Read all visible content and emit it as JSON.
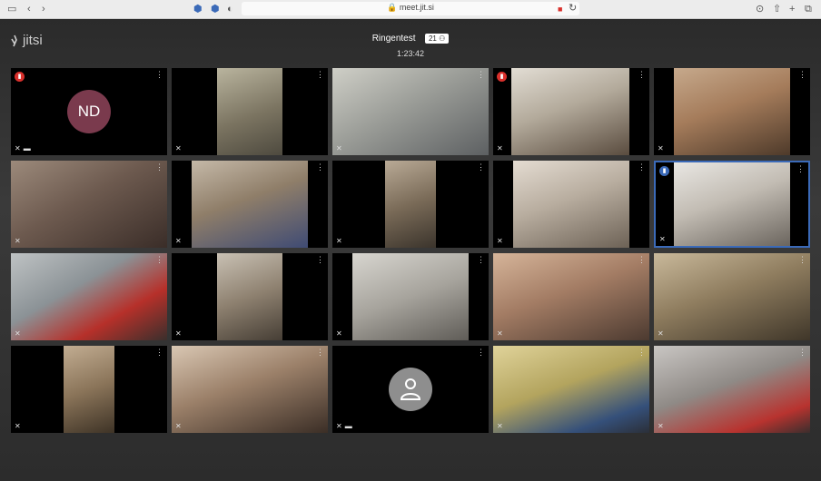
{
  "browser": {
    "url": "meet.jit.si"
  },
  "app": {
    "logo_text": "jitsi",
    "meeting_title": "Ringentest",
    "participant_count": "21",
    "timer": "1:23:42"
  },
  "tiles": [
    {
      "id": "t1",
      "avatar": "ND"
    },
    {
      "id": "t2"
    },
    {
      "id": "t3"
    },
    {
      "id": "t4"
    },
    {
      "id": "t5"
    },
    {
      "id": "t6"
    },
    {
      "id": "t7"
    },
    {
      "id": "t8"
    },
    {
      "id": "t9"
    },
    {
      "id": "t10",
      "active": true,
      "badge": "#3b6ab8"
    },
    {
      "id": "t11"
    },
    {
      "id": "t12"
    },
    {
      "id": "t13"
    },
    {
      "id": "t14"
    },
    {
      "id": "t15"
    },
    {
      "id": "t16"
    },
    {
      "id": "t17"
    },
    {
      "id": "t18"
    },
    {
      "id": "t19"
    },
    {
      "id": "t20"
    }
  ],
  "colors": {
    "accent": "#3b6ab8",
    "badge_red": "#d9302c",
    "badge_yellow": "#f0b429",
    "avatar_bg": "#7a3a4d"
  }
}
